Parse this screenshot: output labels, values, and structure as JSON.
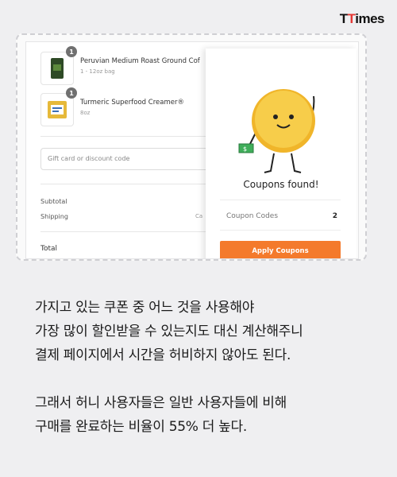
{
  "brand": {
    "part1": "T",
    "part2": "T",
    "part3": "imes"
  },
  "cart": {
    "items": [
      {
        "name": "Peruvian Medium Roast Ground Cof",
        "variant": "1 - 12oz bag",
        "qty": "1",
        "thumb_color": "#2e4a26"
      },
      {
        "name": "Turmeric Superfood Creamer®",
        "variant": "8oz",
        "qty": "1",
        "thumb_color": "#e6b93a"
      }
    ],
    "discount_placeholder": "Gift card or discount code",
    "subtotal_label": "Subtotal",
    "shipping_label": "Shipping",
    "shipping_value": "Ca",
    "total_label": "Total"
  },
  "popup": {
    "title": "Coupons found!",
    "codes_label": "Coupon Codes",
    "codes_count": "2",
    "apply_label": "Apply Coupons",
    "accent": "#f47a2c",
    "mascot_color": "#f5c83a"
  },
  "caption": {
    "lines": [
      "가지고 있는 쿠폰 중 어느 것을 사용해야",
      "가장 많이 할인받을 수 있는지도 대신 계산해주니",
      "결제 페이지에서 시간을 허비하지 않아도 된다.",
      "그래서 허니 사용자들은 일반 사용자들에 비해",
      "구매를 완료하는 비율이 55% 더 높다."
    ]
  }
}
